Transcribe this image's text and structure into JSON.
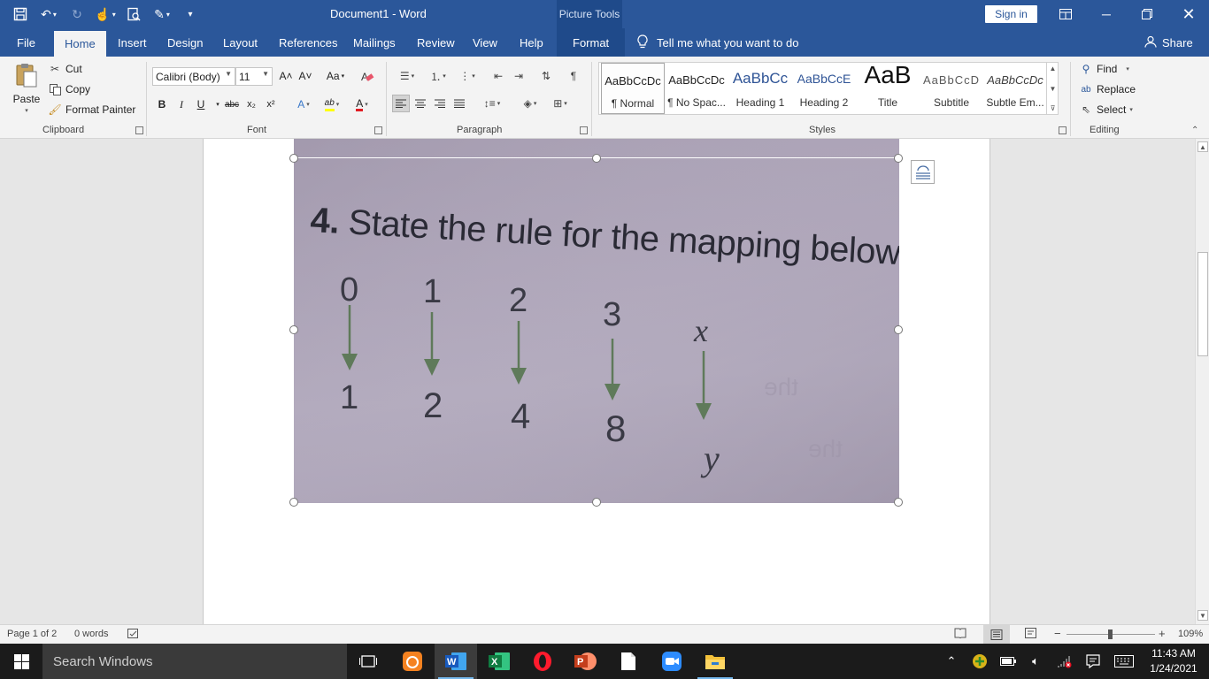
{
  "window": {
    "title": "Document1  -  Word",
    "contextual_tab_group": "Picture Tools",
    "sign_in": "Sign in"
  },
  "tabs": [
    {
      "label": "File"
    },
    {
      "label": "Home"
    },
    {
      "label": "Insert"
    },
    {
      "label": "Design"
    },
    {
      "label": "Layout"
    },
    {
      "label": "References"
    },
    {
      "label": "Mailings"
    },
    {
      "label": "Review"
    },
    {
      "label": "View"
    },
    {
      "label": "Help"
    },
    {
      "label": "Format"
    }
  ],
  "active_tab": "Home",
  "tell_me": "Tell me what you want to do",
  "share": "Share",
  "clipboard": {
    "paste": "Paste",
    "cut": "Cut",
    "copy": "Copy",
    "format_painter": "Format Painter",
    "label": "Clipboard"
  },
  "font": {
    "name": "Calibri (Body)",
    "size": "11",
    "change_case": "Aa",
    "label": "Font",
    "bold": "B",
    "italic": "I",
    "underline": "U",
    "strike": "abc",
    "sub": "x₂",
    "sup": "x²",
    "grow": "A˄",
    "shrink": "A˅",
    "effects": "A",
    "highlight": "ab",
    "color": "A",
    "highlight_color": "#ffff00",
    "font_color": "#e11b22"
  },
  "paragraph": {
    "label": "Paragraph",
    "pilcrow": "¶"
  },
  "styles": {
    "label": "Styles",
    "items": [
      {
        "preview": "AaBbCcDc",
        "name": "¶ Normal"
      },
      {
        "preview": "AaBbCcDc",
        "name": "¶ No Spac..."
      },
      {
        "preview": "AaBbCc",
        "name": "Heading 1"
      },
      {
        "preview": "AaBbCcE",
        "name": "Heading 2"
      },
      {
        "preview": "AaB",
        "name": "Title"
      },
      {
        "preview": "AaBbCcD",
        "name": "Subtitle"
      },
      {
        "preview": "AaBbCcDc",
        "name": "Subtle Em..."
      }
    ]
  },
  "editing": {
    "label": "Editing",
    "find": "Find",
    "replace": "Replace",
    "select": "Select"
  },
  "picture": {
    "heading_number": "4.",
    "heading_text": "State the rule for the mapping below:",
    "inputs": [
      "0",
      "1",
      "2",
      "3",
      "x"
    ],
    "outputs": [
      "1",
      "2",
      "4",
      "8",
      "y"
    ]
  },
  "status": {
    "page": "Page 1 of 2",
    "words": "0 words",
    "zoom": "109%"
  },
  "taskbar": {
    "search_placeholder": "Search Windows",
    "time": "11:43 AM",
    "date": "1/24/2021"
  }
}
